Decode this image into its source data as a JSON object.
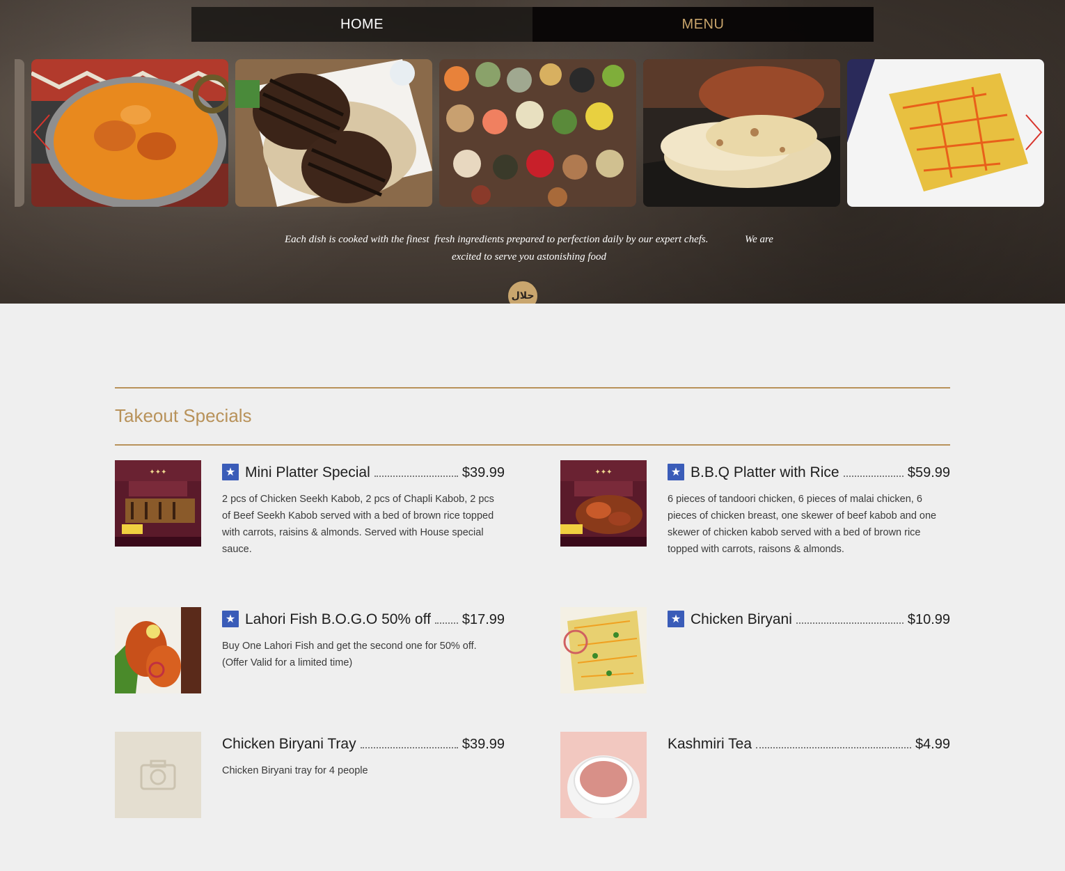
{
  "nav": {
    "home": "HOME",
    "menu": "MENU"
  },
  "gallery": {
    "tiles": [
      "butter-chicken-photo",
      "grilled-beef-with-rice-photo",
      "spices-photo",
      "naan-bread-photo",
      "biryani-rice-photo"
    ]
  },
  "hero": {
    "tagline_line1": "Each dish is cooked with the finest  fresh ingredients prepared to perfection daily by our expert chefs.              We are",
    "tagline_line2": "excited to serve you astonishing food",
    "halal_badge": "حلال"
  },
  "section": {
    "title": "Takeout Specials"
  },
  "items": [
    {
      "name": "Mini Platter Special",
      "price": "$39.99",
      "featured": true,
      "description": "2 pcs of Chicken Seekh Kabob, 2 pcs of Chapli Kabob, 2 pcs of Beef Seekh Kabob served with a bed of brown rice topped with carrots, raisins & almonds. Served with House special sauce."
    },
    {
      "name": "B.B.Q Platter with Rice",
      "price": "$59.99",
      "featured": true,
      "description": "6 pieces of tandoori chicken, 6 pieces of malai chicken, 6 pieces of chicken breast, one skewer of beef kabob and one skewer of chicken kabob served with a bed of brown rice topped with carrots, raisons & almonds."
    },
    {
      "name": "Lahori Fish B.O.G.O 50% off",
      "price": "$17.99",
      "featured": true,
      "description": "Buy One Lahori Fish and get the second one for 50% off. (Offer Valid for a limited time)"
    },
    {
      "name": "Chicken Biryani",
      "price": "$10.99",
      "featured": true,
      "description": ""
    },
    {
      "name": "Chicken Biryani Tray",
      "price": "$39.99",
      "featured": false,
      "description": "Chicken Biryani tray for 4 people"
    },
    {
      "name": "Kashmiri Tea",
      "price": "$4.99",
      "featured": false,
      "description": ""
    }
  ],
  "colors": {
    "accent": "#b8925a",
    "star": "#3a5cb8",
    "nav_bg": "#191614"
  }
}
